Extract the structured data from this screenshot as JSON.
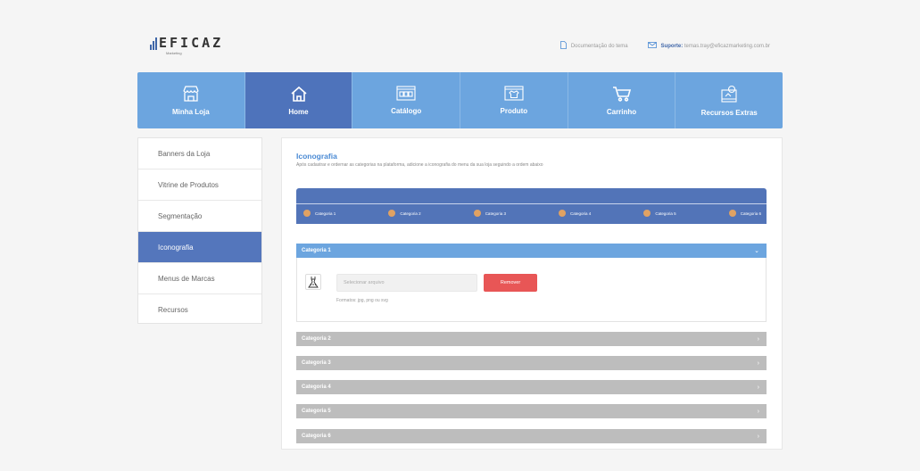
{
  "brand": {
    "name": "EFICAZ",
    "tagline": "Marketing"
  },
  "toplinks": {
    "docs_label": "Documentação do tema",
    "support_label": "Suporte:",
    "support_email": "temas.tray@eficazmarketing.com.br"
  },
  "nav": {
    "items": [
      {
        "label": "Minha Loja",
        "icon": "store-icon",
        "active": false
      },
      {
        "label": "Home",
        "icon": "home-icon",
        "active": true
      },
      {
        "label": "Catálogo",
        "icon": "catalog-icon",
        "active": false
      },
      {
        "label": "Produto",
        "icon": "product-icon",
        "active": false
      },
      {
        "label": "Carrinho",
        "icon": "cart-icon",
        "active": false
      },
      {
        "label": "Recursos Extras",
        "icon": "extras-icon",
        "active": false
      }
    ]
  },
  "sidebar": {
    "items": [
      {
        "label": "Banners da Loja",
        "active": false
      },
      {
        "label": "Vitrine de Produtos",
        "active": false
      },
      {
        "label": "Segmentação",
        "active": false
      },
      {
        "label": "Iconografia",
        "active": true
      },
      {
        "label": "Menus de Marcas",
        "active": false
      },
      {
        "label": "Recursos",
        "active": false
      }
    ]
  },
  "main": {
    "title": "Iconografia",
    "description": "Após cadastrar e ordernar as categorias na plataforma, adicione a iconografia do menu da sua loja seguindo a ordem abaixo",
    "steps": [
      "Categoria 1",
      "Categoria 2",
      "Categoria 3",
      "Categoria 4",
      "Categoria 5",
      "Categoria 6"
    ],
    "accordion": [
      {
        "label": "Categoria 1",
        "open": true
      },
      {
        "label": "Categoria 2",
        "open": false
      },
      {
        "label": "Categoria 3",
        "open": false
      },
      {
        "label": "Categoria 4",
        "open": false
      },
      {
        "label": "Categoria 5",
        "open": false
      },
      {
        "label": "Categoria 6",
        "open": false
      }
    ],
    "upload": {
      "placeholder": "Selecionar arquivo",
      "remove_label": "Remover",
      "formats": "Formatos: jpg, png ou svg"
    }
  },
  "colors": {
    "nav_bg": "#6ca5df",
    "nav_active": "#4e73bb",
    "sidebar_active": "#5476bc",
    "title": "#4a8ad4",
    "remove_button": "#e85656",
    "step_dot": "#e0a263",
    "accordion_closed": "#bdbdbd"
  }
}
